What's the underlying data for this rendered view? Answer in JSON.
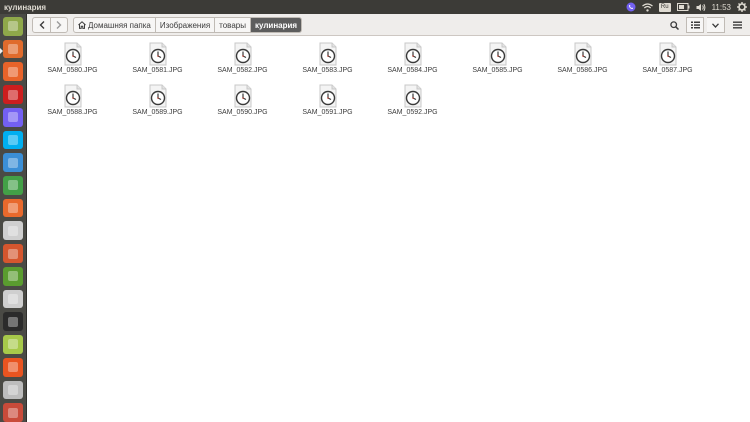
{
  "panel": {
    "app_title": "кулинария",
    "keyboard_layout": "Ru",
    "time": "11:53",
    "icons": [
      "viber-tray-icon",
      "wifi-icon",
      "keyboard-layout-icon",
      "battery-icon",
      "volume-icon",
      "settings-gear-icon"
    ]
  },
  "launcher": {
    "items": [
      {
        "name": "dash-home",
        "color": "#8fa84a"
      },
      {
        "name": "files",
        "color": "#e06b2c"
      },
      {
        "name": "firefox",
        "color": "#e8632a"
      },
      {
        "name": "opera",
        "color": "#cc1e1e"
      },
      {
        "name": "viber",
        "color": "#7360f2"
      },
      {
        "name": "skype",
        "color": "#00aff0"
      },
      {
        "name": "libreoffice-writer",
        "color": "#3b8fd6"
      },
      {
        "name": "libreoffice-calc",
        "color": "#43a047"
      },
      {
        "name": "libreoffice-impress",
        "color": "#e8692c"
      },
      {
        "name": "image-viewer",
        "color": "#cfcfcf"
      },
      {
        "name": "system-settings",
        "color": "#d5562e"
      },
      {
        "name": "app-green",
        "color": "#5a9c2f"
      },
      {
        "name": "image-viewer-2",
        "color": "#cfcfcf"
      },
      {
        "name": "terminal",
        "color": "#2b2b2b"
      },
      {
        "name": "add-image",
        "color": "#a7c94a"
      },
      {
        "name": "software-center",
        "color": "#e95420"
      },
      {
        "name": "printer",
        "color": "#bdbdbd"
      },
      {
        "name": "trash",
        "color": "#c94b3a"
      }
    ]
  },
  "breadcrumbs": [
    {
      "label": "Домашняя папка",
      "icon": "home-icon"
    },
    {
      "label": "Изображения"
    },
    {
      "label": "товары"
    },
    {
      "label": "кулинария",
      "active": true
    }
  ],
  "files": [
    "SAM_0580.JPG",
    "SAM_0581.JPG",
    "SAM_0582.JPG",
    "SAM_0583.JPG",
    "SAM_0584.JPG",
    "SAM_0585.JPG",
    "SAM_0586.JPG",
    "SAM_0587.JPG",
    "SAM_0588.JPG",
    "SAM_0589.JPG",
    "SAM_0590.JPG",
    "SAM_0591.JPG",
    "SAM_0592.JPG"
  ]
}
